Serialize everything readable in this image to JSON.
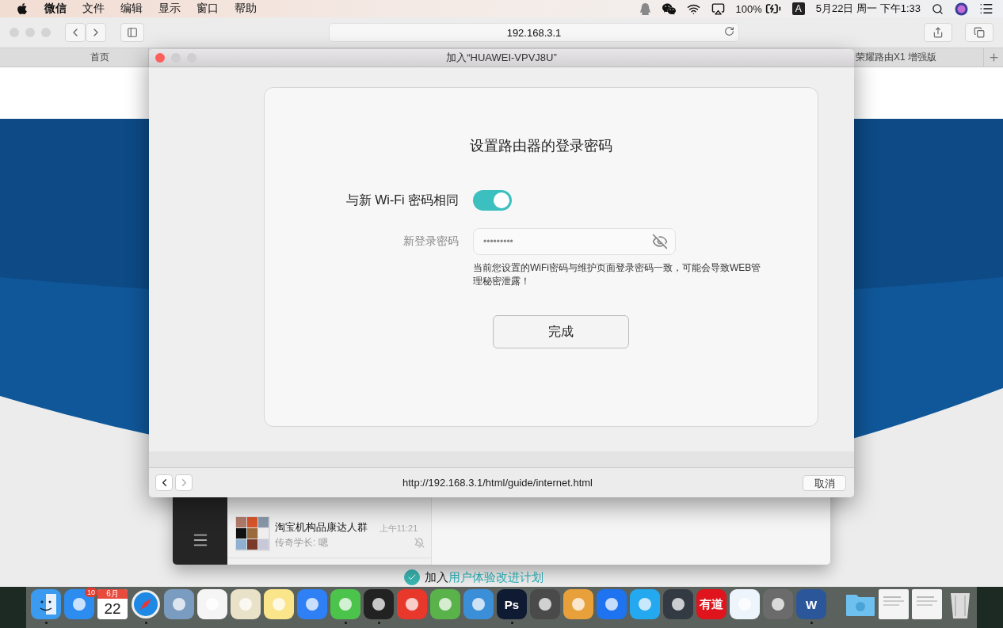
{
  "menu_bar": {
    "app_name": "微信",
    "menus": [
      "文件",
      "编辑",
      "显示",
      "窗口",
      "帮助"
    ],
    "battery": "100%",
    "input_source": "A",
    "clock": "5月22日 周一 下午1:33"
  },
  "browser": {
    "address": "192.168.3.1",
    "tabs": [
      {
        "label": "首页"
      },
      {
        "label": "荣耀路由X1 增强版"
      }
    ],
    "footer": {
      "prefix": "加入",
      "link": "用户体验改进计划",
      "checked": true
    }
  },
  "chat_window": {
    "chat": {
      "name": "淘宝机构品康达人群",
      "time": "上午11:21",
      "preview": "传奇学长: 嗯",
      "muted": true
    }
  },
  "dialog": {
    "title": "加入“HUAWEI-VPVJ8U”",
    "heading": "设置路由器的登录密码",
    "toggle": {
      "label": "与新 Wi-Fi 密码相同",
      "on": true
    },
    "password": {
      "label": "新登录密码",
      "value": "•••••••••"
    },
    "warning": "当前您设置的WiFi密码与维护页面登录密码一致，可能会导致WEB管理秘密泄露！",
    "button": "完成",
    "url": "http://192.168.3.1/html/guide/internet.html",
    "cancel": "取消"
  },
  "dock": {
    "items": [
      {
        "kind": "finder",
        "color": "#3a9bf0",
        "running": true
      },
      {
        "kind": "app",
        "color": "#2d8cf0",
        "running": false,
        "badge": "10"
      },
      {
        "kind": "calendar",
        "color": "#ffffff",
        "running": false,
        "month": "6月",
        "day": "22"
      },
      {
        "kind": "compass",
        "color": "#1e88e5",
        "running": true
      },
      {
        "kind": "app",
        "color": "#7a9cc0",
        "running": false
      },
      {
        "kind": "app",
        "color": "#f5f5f5",
        "running": false
      },
      {
        "kind": "app",
        "color": "#e9e2c8",
        "running": false
      },
      {
        "kind": "app",
        "color": "#fbe58a",
        "running": false
      },
      {
        "kind": "app",
        "color": "#2f7ff5",
        "running": false
      },
      {
        "kind": "app",
        "color": "#4cc44c",
        "running": true
      },
      {
        "kind": "app",
        "color": "#222222",
        "running": true
      },
      {
        "kind": "app",
        "color": "#e8382c",
        "running": false
      },
      {
        "kind": "app",
        "color": "#59b34a",
        "running": false
      },
      {
        "kind": "app",
        "color": "#3b8fd8",
        "running": false
      },
      {
        "kind": "app",
        "color": "#0f1b33",
        "running": true,
        "label": "Ps"
      },
      {
        "kind": "app",
        "color": "#4a4a4a",
        "running": false
      },
      {
        "kind": "app",
        "color": "#e8a13a",
        "running": false
      },
      {
        "kind": "app",
        "color": "#1e74f0",
        "running": false
      },
      {
        "kind": "app",
        "color": "#24a8f0",
        "running": false
      },
      {
        "kind": "app",
        "color": "#333a44",
        "running": false
      },
      {
        "kind": "app",
        "color": "#e0141c",
        "running": false,
        "label": "有道"
      },
      {
        "kind": "app",
        "color": "#eef4fc",
        "running": false
      },
      {
        "kind": "app",
        "color": "#6b6b6b",
        "running": false
      },
      {
        "kind": "app",
        "color": "#2b579a",
        "running": true,
        "label": "W"
      },
      {
        "kind": "separator"
      },
      {
        "kind": "folder",
        "color": "#6ec1ee",
        "running": false
      },
      {
        "kind": "document",
        "color": "#f4f4f4",
        "running": false
      },
      {
        "kind": "document",
        "color": "#f4f4f4",
        "running": false
      },
      {
        "kind": "trash",
        "color": "#dcdcdc",
        "running": false
      }
    ]
  }
}
